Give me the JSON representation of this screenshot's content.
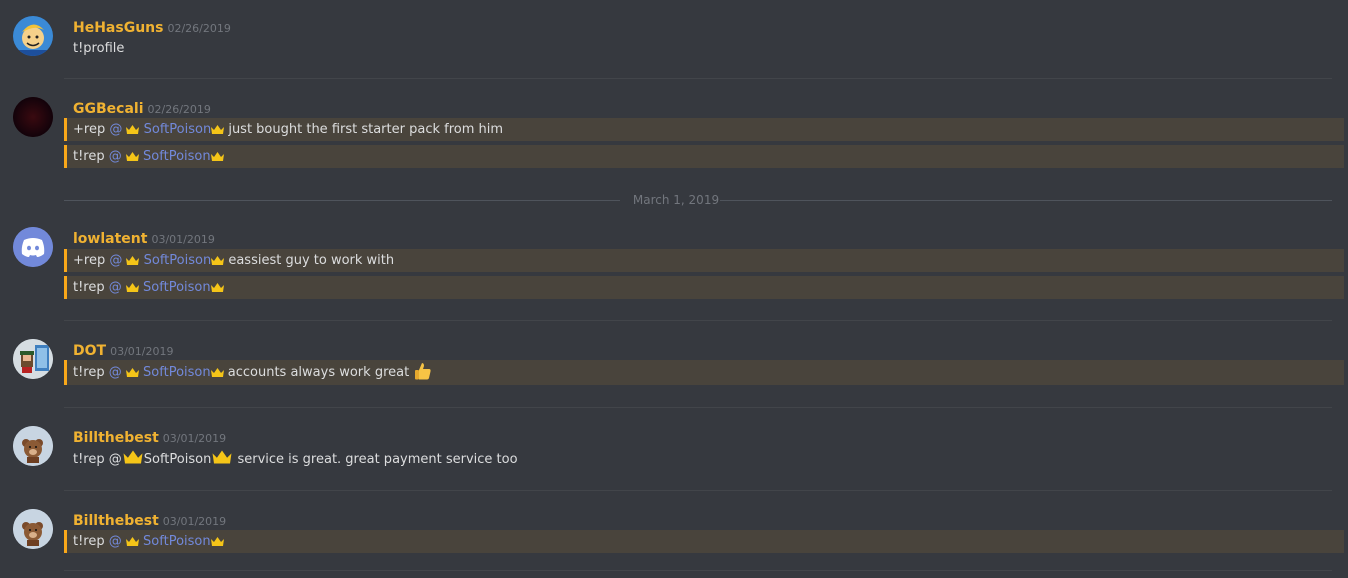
{
  "messages": [
    {
      "username": "HeHasGuns",
      "timestamp": "02/26/2019",
      "avatar_icon": "vault-boy-avatar",
      "lines": [
        {
          "text": "t!profile",
          "highlight": false
        }
      ]
    },
    {
      "username": "GGBecali",
      "timestamp": "02/26/2019",
      "avatar_icon": "dark-red-avatar",
      "lines": [
        {
          "pre": "+rep",
          "mention": "SoftPoison",
          "post": "just bought the first starter pack from him",
          "highlight": true
        },
        {
          "pre": "t!rep",
          "mention": "SoftPoison",
          "post": "",
          "highlight": true
        }
      ]
    },
    {
      "username": "lowlatent",
      "timestamp": "03/01/2019",
      "avatar_icon": "discord-logo-avatar",
      "lines": [
        {
          "pre": "+rep",
          "mention": "SoftPoison",
          "post": "eassiest guy to work with",
          "highlight": true
        },
        {
          "pre": "t!rep",
          "mention": "SoftPoison",
          "post": "",
          "highlight": true
        }
      ]
    },
    {
      "username": "DOT",
      "timestamp": "03/01/2019",
      "avatar_icon": "pixel-character-avatar",
      "lines": [
        {
          "pre": "t!rep",
          "mention": "SoftPoison",
          "post": "accounts always work great",
          "highlight": true,
          "emoji": "thumbs-up-emoji"
        }
      ]
    },
    {
      "username": "Billthebest",
      "timestamp": "03/01/2019",
      "avatar_icon": "teddy-bear-avatar",
      "lines": [
        {
          "text": "t!rep @👑SoftPoison👑 service is great. great payment service too",
          "pre": "t!rep @",
          "mention": "SoftPoison",
          "post": "service is great. great payment service too",
          "highlight": false
        }
      ]
    },
    {
      "username": "Billthebest",
      "timestamp": "03/01/2019",
      "avatar_icon": "teddy-bear-avatar",
      "lines": [
        {
          "pre": "t!rep",
          "mention": "SoftPoison",
          "post": "",
          "highlight": true
        }
      ]
    }
  ],
  "date_separator": "March 1, 2019",
  "colors": {
    "background": "#36393f",
    "username": "#f0b232",
    "mention": "#7289da",
    "highlight_bg": "#49443c",
    "highlight_border": "#faa81a"
  }
}
